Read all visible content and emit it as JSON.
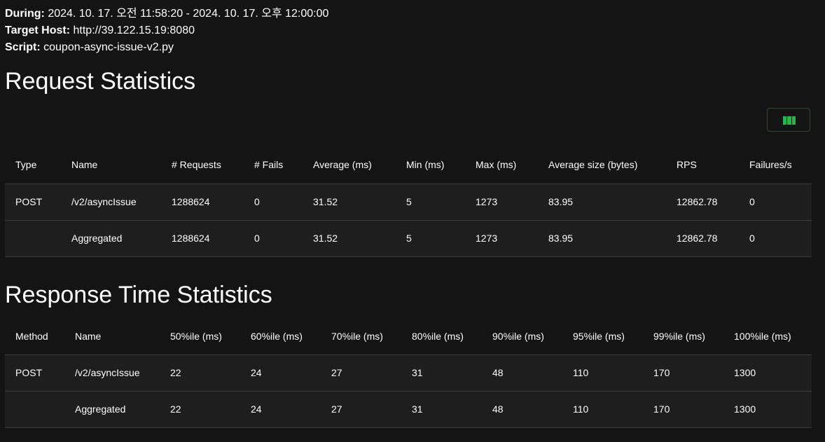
{
  "meta": {
    "during_label": "During:",
    "during_value": "2024. 10. 17. 오전 11:58:20 - 2024. 10. 17. 오후 12:00:00",
    "host_label": "Target Host:",
    "host_value": "http://39.122.15.19:8080",
    "script_label": "Script:",
    "script_value": "coupon-async-issue-v2.py"
  },
  "request_stats": {
    "title": "Request Statistics",
    "columns_button_icon": "columns-icon",
    "headers": [
      "Type",
      "Name",
      "# Requests",
      "# Fails",
      "Average (ms)",
      "Min (ms)",
      "Max (ms)",
      "Average size (bytes)",
      "RPS",
      "Failures/s"
    ],
    "rows": [
      [
        "POST",
        "/v2/asyncIssue",
        "1288624",
        "0",
        "31.52",
        "5",
        "1273",
        "83.95",
        "12862.78",
        "0"
      ],
      [
        "",
        "Aggregated",
        "1288624",
        "0",
        "31.52",
        "5",
        "1273",
        "83.95",
        "12862.78",
        "0"
      ]
    ]
  },
  "response_stats": {
    "title": "Response Time Statistics",
    "headers": [
      "Method",
      "Name",
      "50%ile (ms)",
      "60%ile (ms)",
      "70%ile (ms)",
      "80%ile (ms)",
      "90%ile (ms)",
      "95%ile (ms)",
      "99%ile (ms)",
      "100%ile (ms)"
    ],
    "rows": [
      [
        "POST",
        "/v2/asyncIssue",
        "22",
        "24",
        "27",
        "31",
        "48",
        "110",
        "170",
        "1300"
      ],
      [
        "",
        "Aggregated",
        "22",
        "24",
        "27",
        "31",
        "48",
        "110",
        "170",
        "1300"
      ]
    ]
  },
  "colors": {
    "background": "#141414",
    "row_background": "#1e1e1e",
    "accent_green": "#2bb34a"
  }
}
